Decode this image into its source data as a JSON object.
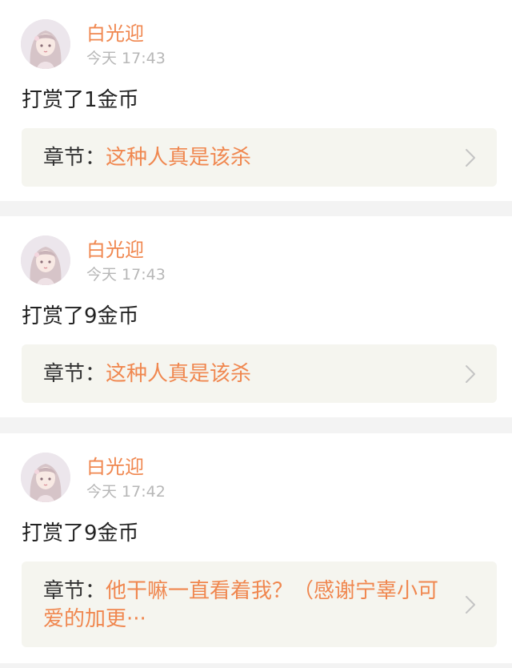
{
  "feed": {
    "items": [
      {
        "username": "白光迎",
        "time": "今天 17:43",
        "action": "打赏了1金币",
        "chapter_prefix": "章节：",
        "chapter_title": "这种人真是该杀"
      },
      {
        "username": "白光迎",
        "time": "今天 17:43",
        "action": "打赏了9金币",
        "chapter_prefix": "章节：",
        "chapter_title": "这种人真是该杀"
      },
      {
        "username": "白光迎",
        "time": "今天 17:42",
        "action": "打赏了9金币",
        "chapter_prefix": "章节：",
        "chapter_title": "他干嘛一直看着我？（感谢宁辜小可爱的加更···"
      }
    ]
  },
  "colors": {
    "accent": "#f0874f",
    "text": "#222222",
    "secondary": "#b7b7b7",
    "chapter_bg": "#f5f5ef",
    "page_bg": "#f3f3f3"
  }
}
